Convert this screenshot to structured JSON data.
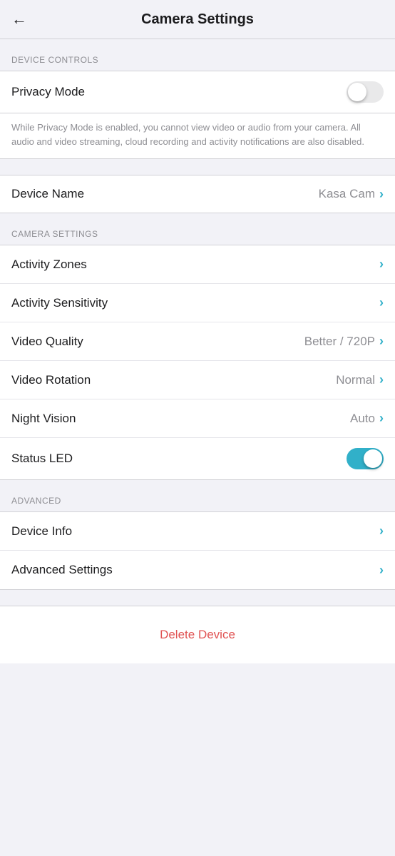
{
  "header": {
    "back_icon": "←",
    "title": "Camera Settings"
  },
  "sections": {
    "device_controls": {
      "label": "Device Controls",
      "privacy_mode": {
        "label": "Privacy Mode",
        "toggle_state": "off",
        "description": "While Privacy Mode is enabled, you cannot view video or audio from your camera. All audio and video streaming, cloud recording and activity notifications are also disabled."
      },
      "device_name": {
        "label": "Device Name",
        "value": "Kasa Cam"
      }
    },
    "camera_settings": {
      "label": "Camera Settings",
      "items": [
        {
          "label": "Activity Zones",
          "value": "",
          "has_chevron": true
        },
        {
          "label": "Activity Sensitivity",
          "value": "",
          "has_chevron": true
        },
        {
          "label": "Video Quality",
          "value": "Better / 720P",
          "has_chevron": true
        },
        {
          "label": "Video Rotation",
          "value": "Normal",
          "has_chevron": true
        },
        {
          "label": "Night Vision",
          "value": "Auto",
          "has_chevron": true
        },
        {
          "label": "Status LED",
          "value": "",
          "toggle": true,
          "toggle_state": "on"
        }
      ]
    },
    "advanced": {
      "label": "Advanced",
      "items": [
        {
          "label": "Device Info",
          "value": "",
          "has_chevron": true
        },
        {
          "label": "Advanced Settings",
          "value": "",
          "has_chevron": true
        }
      ]
    }
  },
  "delete_button": {
    "label": "Delete Device"
  },
  "colors": {
    "accent": "#31b0c9",
    "delete": "#e05252",
    "section_label": "#8e8e93",
    "value_text": "#8e8e93"
  },
  "icons": {
    "chevron": "›",
    "back": "←"
  }
}
